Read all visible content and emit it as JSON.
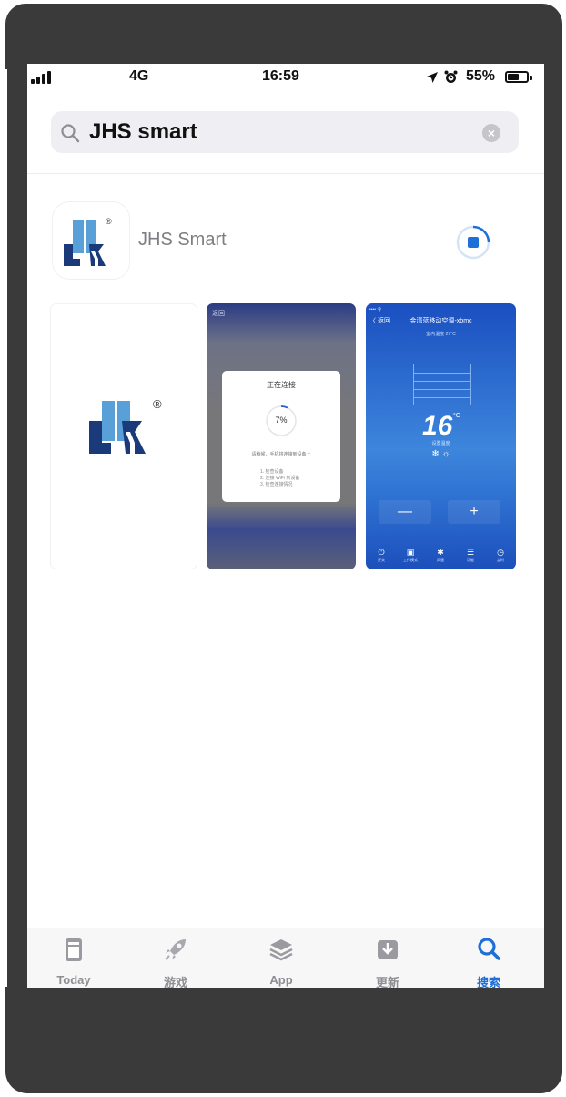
{
  "status_bar": {
    "carrier": "4G",
    "time": "16:59",
    "battery": "55%",
    "icons": [
      "signal-icon",
      "location-icon",
      "alarm-icon",
      "battery-icon"
    ]
  },
  "search": {
    "query": "JHS smart",
    "icons": [
      "search-icon",
      "clear-icon"
    ]
  },
  "result": {
    "app_name": "JHS Smart",
    "download_state": "downloading",
    "logo_mark": "JHS ®",
    "screenshot2": {
      "header": "返回",
      "dialog_title": "正在连接",
      "progress": "7%",
      "message": "请稍候，手机将连接到设备上",
      "steps": [
        "1. 检查设备",
        "2. 连接 WiFi 到设备",
        "3. 检查连接情况"
      ]
    },
    "screenshot3": {
      "status": "•••• 令",
      "back": "〈 返回",
      "title": "金湾蓝移动空调-xbmc",
      "subtitle": "室内温度 27°C",
      "temperature": "16",
      "degree": "°C",
      "mode": "设置温度",
      "mode_icons": "❄ ☼",
      "minus": "—",
      "plus": "+",
      "bottom_items": [
        {
          "icon": "⏻",
          "label": "开关"
        },
        {
          "icon": "▣",
          "label": "工作模式"
        },
        {
          "icon": "✱",
          "label": "风速"
        },
        {
          "icon": "☰",
          "label": "功能"
        },
        {
          "icon": "◷",
          "label": "定时"
        }
      ]
    }
  },
  "tab_bar": {
    "active": "搜索",
    "tabs": [
      {
        "label": "Today",
        "icon": "today-icon"
      },
      {
        "label": "游戏",
        "icon": "rocket-icon"
      },
      {
        "label": "App",
        "icon": "apps-stack-icon"
      },
      {
        "label": "更新",
        "icon": "updates-icon"
      },
      {
        "label": "搜索",
        "icon": "search-icon"
      }
    ]
  },
  "colors": {
    "accent": "#1f6fd8",
    "bezel": "#3a3a3a",
    "logo_dark": "#1a3a7a",
    "logo_light": "#5aa0d8"
  }
}
